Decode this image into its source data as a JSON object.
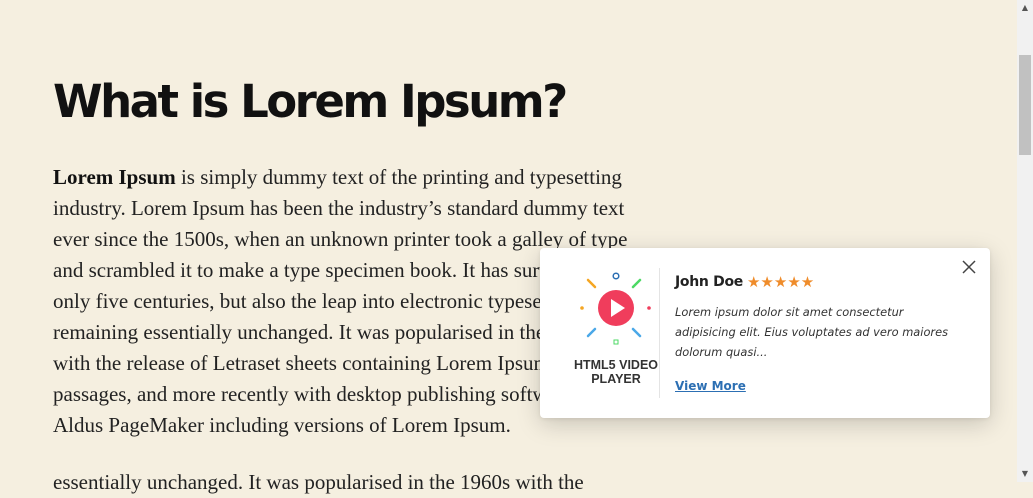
{
  "article": {
    "title": "What is Lorem Ipsum?",
    "lead_bold": "Lorem Ipsum",
    "para1_rest": " is simply dummy text of the printing and typesetting industry. Lorem Ipsum has been the industry’s standard dummy text ever since the 1500s, when an unknown printer took a galley of type and scrambled it to make a type specimen book. It has survived not only five centuries, but also the leap into electronic typesetting, remaining essentially unchanged. It was popularised in the 1960s with the release of Letraset sheets containing Lorem Ipsum passages, and more recently with desktop publishing software like Aldus PageMaker including versions of Lorem Ipsum.",
    "para2": "essentially unchanged. It was popularised in the 1960s with the"
  },
  "popup": {
    "logo_caption": "HTML5 VIDEO\nPLAYER",
    "name": "John Doe",
    "stars": "★★★★★",
    "rating": 5,
    "description": "Lorem ipsum dolor sit amet consectetur adipisicing elit. Eius voluptates ad vero maiores dolorum quasi...",
    "view_more_label": "View More",
    "colors": {
      "star": "#ef8c2b",
      "link": "#2c6fb3",
      "play": "#f03d5c"
    }
  }
}
